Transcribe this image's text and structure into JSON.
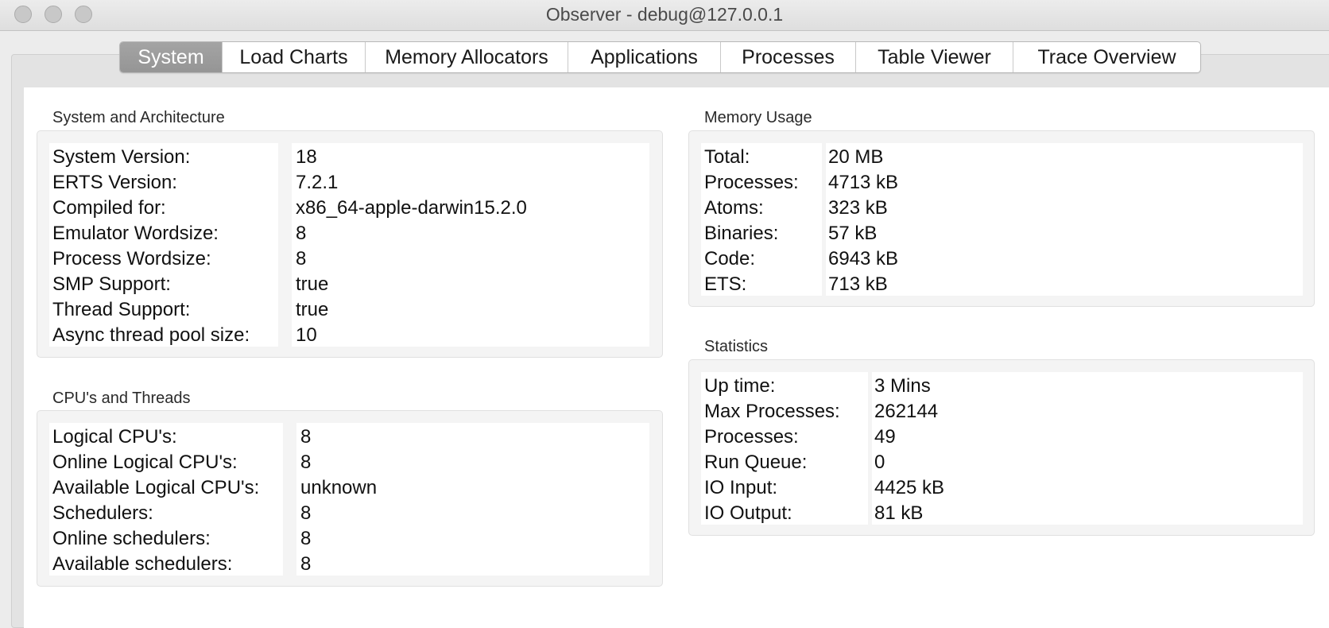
{
  "window": {
    "title": "Observer - debug@127.0.0.1"
  },
  "tabs": [
    {
      "label": "System",
      "active": true
    },
    {
      "label": "Load Charts",
      "active": false
    },
    {
      "label": "Memory Allocators",
      "active": false
    },
    {
      "label": "Applications",
      "active": false
    },
    {
      "label": "Processes",
      "active": false
    },
    {
      "label": "Table Viewer",
      "active": false
    },
    {
      "label": "Trace Overview",
      "active": false
    }
  ],
  "system_arch": {
    "title": "System and Architecture",
    "rows": [
      {
        "label": "System Version:",
        "value": "18"
      },
      {
        "label": "ERTS Version:",
        "value": "7.2.1"
      },
      {
        "label": "Compiled for:",
        "value": "x86_64-apple-darwin15.2.0"
      },
      {
        "label": "Emulator Wordsize:",
        "value": "8"
      },
      {
        "label": "Process Wordsize:",
        "value": "8"
      },
      {
        "label": "SMP Support:",
        "value": "true"
      },
      {
        "label": "Thread Support:",
        "value": "true"
      },
      {
        "label": "Async thread pool size:",
        "value": "10"
      }
    ]
  },
  "cpus_threads": {
    "title": "CPU's and Threads",
    "rows": [
      {
        "label": "Logical CPU's:",
        "value": "8"
      },
      {
        "label": "Online Logical CPU's:",
        "value": "8"
      },
      {
        "label": "Available Logical CPU's:",
        "value": "unknown"
      },
      {
        "label": "Schedulers:",
        "value": "8"
      },
      {
        "label": "Online schedulers:",
        "value": "8"
      },
      {
        "label": "Available schedulers:",
        "value": "8"
      }
    ]
  },
  "memory_usage": {
    "title": "Memory Usage",
    "rows": [
      {
        "label": "Total:",
        "value": "20 MB"
      },
      {
        "label": "Processes:",
        "value": "4713 kB"
      },
      {
        "label": "Atoms:",
        "value": "323 kB"
      },
      {
        "label": "Binaries:",
        "value": "57 kB"
      },
      {
        "label": "Code:",
        "value": "6943 kB"
      },
      {
        "label": "ETS:",
        "value": "713 kB"
      }
    ]
  },
  "statistics": {
    "title": "Statistics",
    "rows": [
      {
        "label": "Up time:",
        "value": "3 Mins"
      },
      {
        "label": "Max Processes:",
        "value": "262144"
      },
      {
        "label": "Processes:",
        "value": "49"
      },
      {
        "label": "Run Queue:",
        "value": "0"
      },
      {
        "label": "IO Input:",
        "value": "4425 kB"
      },
      {
        "label": "IO Output:",
        "value": "81 kB"
      }
    ]
  }
}
